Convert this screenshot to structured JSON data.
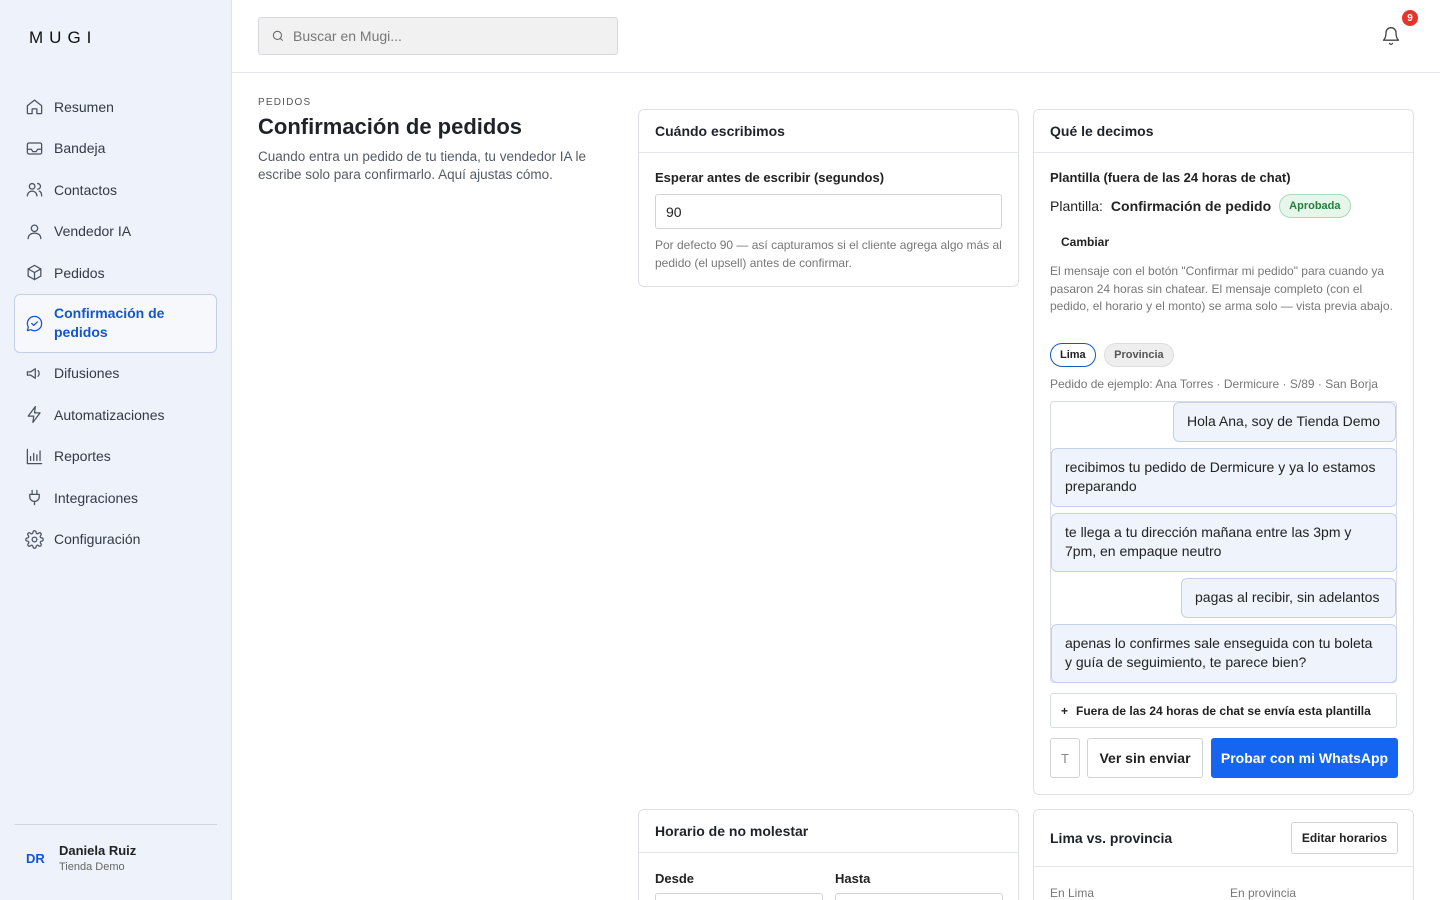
{
  "sidebar": {
    "logo": "MUGI",
    "items": [
      {
        "label": "Resumen",
        "icon": "home-icon"
      },
      {
        "label": "Bandeja",
        "icon": "inbox-icon"
      },
      {
        "label": "Contactos",
        "icon": "users-icon"
      },
      {
        "label": "Vendedor IA",
        "icon": "user-icon"
      },
      {
        "label": "Pedidos",
        "icon": "box-icon"
      },
      {
        "label": "Confirmación de pedidos",
        "icon": "chat-check-icon",
        "active": true
      },
      {
        "label": "Difusiones",
        "icon": "megaphone-icon"
      },
      {
        "label": "Automatizaciones",
        "icon": "bolt-icon"
      },
      {
        "label": "Reportes",
        "icon": "bar-chart-icon"
      },
      {
        "label": "Integraciones",
        "icon": "plug-icon"
      },
      {
        "label": "Configuración",
        "icon": "gear-icon"
      }
    ],
    "user": {
      "initials": "DR",
      "name": "Daniela Ruiz",
      "store": "Tienda Demo"
    }
  },
  "topbar": {
    "search_placeholder": "Buscar en Mugi...",
    "notifications_count": "9"
  },
  "page": {
    "eyebrow": "PEDIDOS",
    "title": "Confirmación de pedidos",
    "description": "Cuando entra un pedido de tu tienda, tu vendedor IA le escribe solo para confirmarlo. Aquí ajustas cómo."
  },
  "when_card": {
    "title": "Cuándo escribimos",
    "wait_label": "Esperar antes de escribir (segundos)",
    "wait_value": "90",
    "help": "Por defecto 90 — así capturamos si el cliente agrega algo más al pedido (el upsell) antes de confirmar."
  },
  "what_card": {
    "title": "Qué le decimos",
    "template_heading": "Plantilla (fuera de las 24 horas de chat)",
    "template_prefix": "Plantilla:",
    "template_name": "Confirmación de pedido",
    "template_status": "Aprobada",
    "change_label": "Cambiar",
    "description": "El mensaje con el botón \"Confirmar mi pedido\" para cuando ya pasaron 24 horas sin chatear. El mensaje completo (con el pedido, el horario y el monto) se arma solo — vista previa abajo.",
    "region_chips": [
      "Lima",
      "Provincia"
    ],
    "example_order": "Pedido de ejemplo: Ana Torres · Dermicure · S/89 · San Borja",
    "messages": [
      "Hola Ana, soy de Tienda Demo",
      "recibimos tu pedido de Dermicure y ya lo estamos preparando",
      "te llega a tu dirección mañana entre las 3pm y 7pm, en empaque neutro",
      "pagas al recibir, sin adelantos",
      "apenas lo confirmes sale enseguida con tu boleta y guía de seguimiento, te parece bien?"
    ],
    "collapse_label": "Fuera de las 24 horas de chat se envía esta plantilla",
    "collapse_symbol": "+",
    "phone_input_value": "T",
    "preview_button": "Ver sin enviar",
    "test_button": "Probar con mi WhatsApp"
  },
  "quiet_card": {
    "title": "Horario de no molestar",
    "from_label": "Desde",
    "to_label": "Hasta"
  },
  "region_card": {
    "title": "Lima vs. provincia",
    "edit_button": "Editar horarios",
    "lima_label": "En Lima",
    "province_label": "En provincia"
  }
}
